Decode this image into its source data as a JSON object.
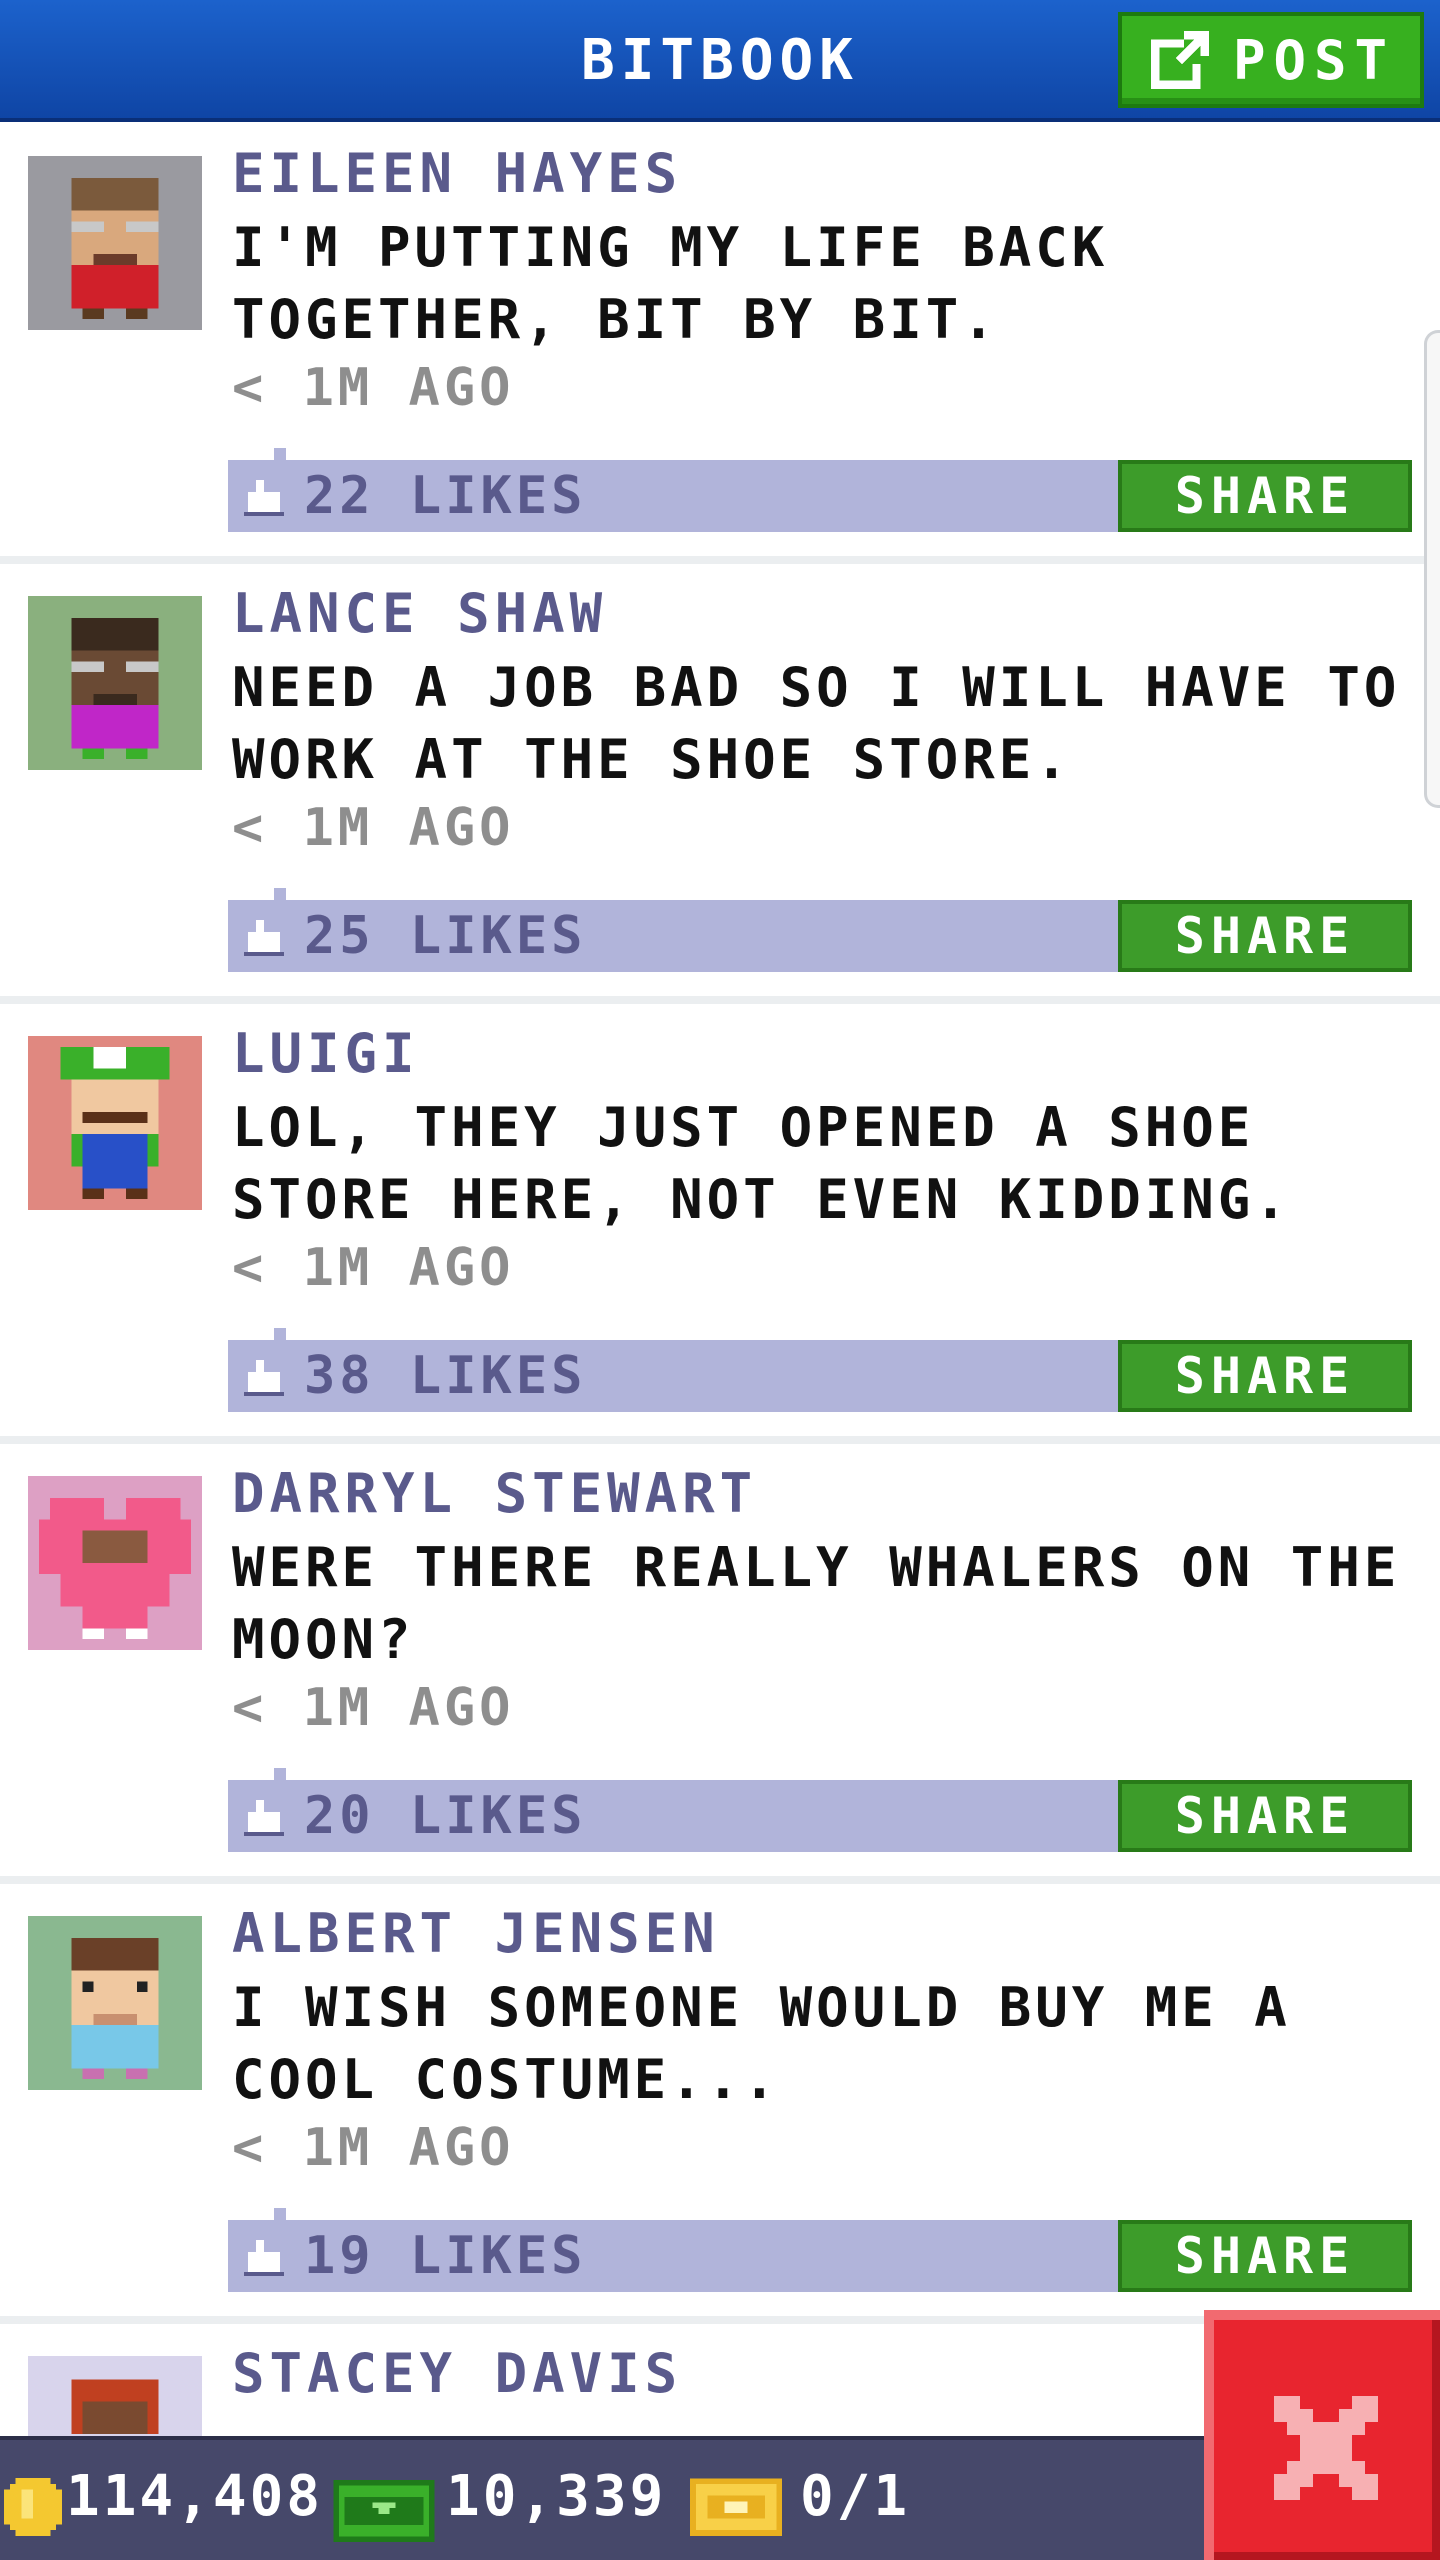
{
  "header": {
    "title": "BITBOOK",
    "post_label": "POST"
  },
  "posts": [
    {
      "name": "EILEEN HAYES",
      "message": "I'M PUTTING MY LIFE BACK TOGETHER, BIT BY BIT.",
      "time": "< 1M AGO",
      "likes": "22 LIKES",
      "share_label": "SHARE"
    },
    {
      "name": "LANCE SHAW",
      "message": "NEED A JOB BAD SO I WILL HAVE TO WORK AT THE SHOE STORE.",
      "time": "< 1M AGO",
      "likes": "25 LIKES",
      "share_label": "SHARE"
    },
    {
      "name": "LUIGI",
      "message": "LOL, THEY JUST OPENED A SHOE STORE HERE, NOT EVEN KIDDING.",
      "time": "< 1M AGO",
      "likes": "38 LIKES",
      "share_label": "SHARE"
    },
    {
      "name": "DARRYL STEWART",
      "message": "WERE THERE REALLY WHALERS ON THE MOON?",
      "time": "< 1M AGO",
      "likes": "20 LIKES",
      "share_label": "SHARE"
    },
    {
      "name": "ALBERT JENSEN",
      "message": "I WISH SOMEONE WOULD BUY ME A COOL COSTUME...",
      "time": "< 1M AGO",
      "likes": "19 LIKES",
      "share_label": "SHARE"
    }
  ],
  "partial_post": {
    "name": "STACEY DAVIS"
  },
  "status": {
    "coins": "114,408",
    "bux": "10,339",
    "tickets": "0/1"
  },
  "icons": {
    "post": "edit-icon",
    "like": "like-icon",
    "coin": "coin-icon",
    "bux": "cash-icon",
    "ticket": "ticket-icon",
    "close": "close-icon"
  },
  "colors": {
    "header": "#1c62cc",
    "post_button": "#37b01f",
    "share_button": "#3d9c2a",
    "likes_bar": "#b1b4da",
    "name_text": "#5a5a8c",
    "status_bar": "#46486a",
    "close_button": "#e8252f"
  }
}
